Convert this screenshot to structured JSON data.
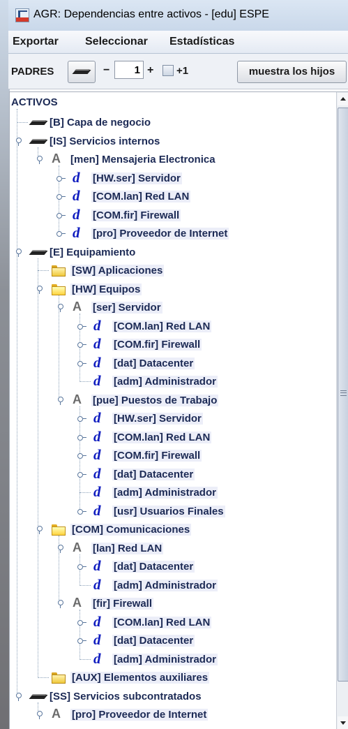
{
  "window": {
    "title": "AGR: Dependencias entre activos - [edu] ESPE"
  },
  "menu": [
    "Exportar",
    "Seleccionar",
    "Estadísticas"
  ],
  "toolbar": {
    "padres_label": "PADRES",
    "minus_label": "−",
    "level_value": "1",
    "plus_label": "+",
    "plus1_label": "+1",
    "show_children_label": "muestra los hijos"
  },
  "tree": {
    "root": "ACTIVOS",
    "rows": [
      {
        "label": "[B] Capa de negocio",
        "icon": "layer-icon"
      },
      {
        "label": "[IS] Servicios internos",
        "icon": "layer-icon"
      },
      {
        "label": "[men] Mensajeria Electronica",
        "icon": "asset-A-icon"
      },
      {
        "label": "[HW.ser] Servidor",
        "icon": "dependency-d-icon"
      },
      {
        "label": "[COM.lan] Red LAN",
        "icon": "dependency-d-icon"
      },
      {
        "label": "[COM.fir] Firewall",
        "icon": "dependency-d-icon"
      },
      {
        "label": "[pro] Proveedor de Internet",
        "icon": "dependency-d-icon"
      },
      {
        "label": "[E] Equipamiento",
        "icon": "layer-icon"
      },
      {
        "label": "[SW] Aplicaciones",
        "icon": "folder-icon"
      },
      {
        "label": "[HW] Equipos",
        "icon": "folder-open-icon"
      },
      {
        "label": "[ser] Servidor",
        "icon": "asset-A-icon"
      },
      {
        "label": "[COM.lan] Red LAN",
        "icon": "dependency-d-icon"
      },
      {
        "label": "[COM.fir] Firewall",
        "icon": "dependency-d-icon"
      },
      {
        "label": "[dat] Datacenter",
        "icon": "dependency-d-icon"
      },
      {
        "label": "[adm] Administrador",
        "icon": "dependency-d-icon"
      },
      {
        "label": "[pue] Puestos de Trabajo",
        "icon": "asset-A-icon"
      },
      {
        "label": "[HW.ser] Servidor",
        "icon": "dependency-d-icon"
      },
      {
        "label": "[COM.lan] Red LAN",
        "icon": "dependency-d-icon"
      },
      {
        "label": "[COM.fir] Firewall",
        "icon": "dependency-d-icon"
      },
      {
        "label": "[dat] Datacenter",
        "icon": "dependency-d-icon"
      },
      {
        "label": "[adm] Administrador",
        "icon": "dependency-d-icon"
      },
      {
        "label": "[usr] Usuarios Finales",
        "icon": "dependency-d-icon"
      },
      {
        "label": "[COM] Comunicaciones",
        "icon": "folder-open-icon"
      },
      {
        "label": "[lan] Red LAN",
        "icon": "asset-A-icon"
      },
      {
        "label": "[dat] Datacenter",
        "icon": "dependency-d-icon"
      },
      {
        "label": "[adm] Administrador",
        "icon": "dependency-d-icon"
      },
      {
        "label": "[fir] Firewall",
        "icon": "asset-A-icon"
      },
      {
        "label": "[COM.lan] Red LAN",
        "icon": "dependency-d-icon"
      },
      {
        "label": "[dat] Datacenter",
        "icon": "dependency-d-icon"
      },
      {
        "label": "[adm] Administrador",
        "icon": "dependency-d-icon"
      },
      {
        "label": "[AUX] Elementos auxiliares",
        "icon": "folder-icon"
      },
      {
        "label": "[SS] Servicios subcontratados",
        "icon": "layer-icon"
      },
      {
        "label": "[pro] Proveedor de Internet",
        "icon": "asset-A-icon"
      }
    ]
  }
}
